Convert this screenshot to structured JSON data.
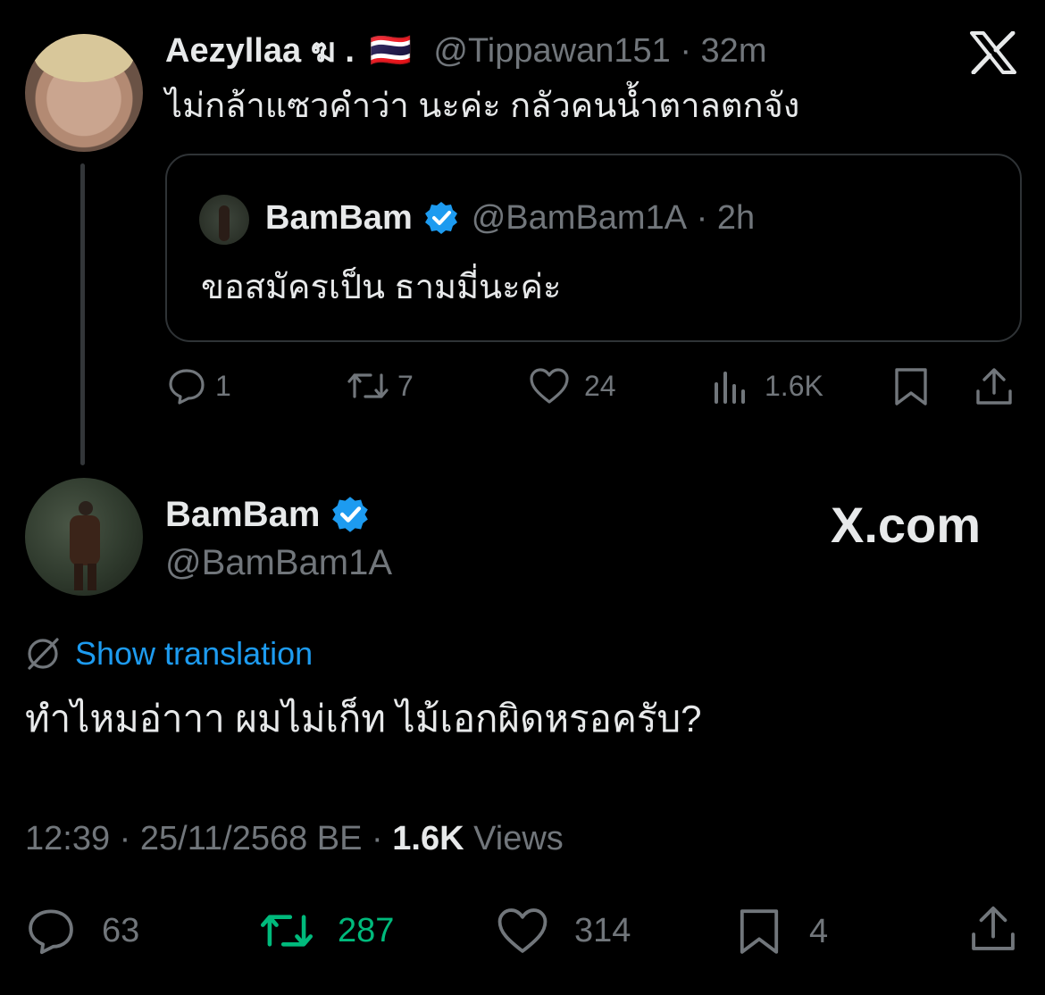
{
  "reply_tweet": {
    "display_name": "Aezyllaa ฆ .",
    "flag": "🇹🇭",
    "handle": "@Tippawan151",
    "time": "32m",
    "text": "ไม่กล้าแซวคำว่า นะค่ะ กลัวคนน้ำตาลตกจัง",
    "quoted": {
      "display_name": "BamBam",
      "handle": "@BamBam1A",
      "time": "2h",
      "text": "ขอสมัครเป็น ธามมี่นะค่ะ"
    },
    "stats": {
      "replies": "1",
      "reposts": "7",
      "likes": "24",
      "views": "1.6K"
    }
  },
  "main_tweet": {
    "display_name": "BamBam",
    "handle": "@BamBam1A",
    "brand": "X.com",
    "translate_label": "Show translation",
    "text": "ทำไหมอ่าาา ผมไม่เก็ท ไม้เอกผิดหรอครับ?",
    "time": "12:39",
    "date": "25/11/2568 BE",
    "views_count": "1.6K",
    "views_label": "Views",
    "stats": {
      "replies": "63",
      "reposts": "287",
      "likes": "314",
      "bookmarks": "4"
    }
  },
  "colors": {
    "background": "#000000",
    "text": "#e7e9ea",
    "muted": "#71767b",
    "link": "#1d9bf0",
    "repost_active": "#00ba7c",
    "verified": "#1d9bf0"
  }
}
